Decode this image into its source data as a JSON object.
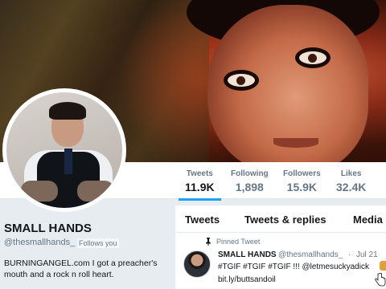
{
  "profile": {
    "name": "SMALL HANDS",
    "handle": "@thesmallhands_",
    "follows_you": "Follows you",
    "bio": "BURNINGANGEL.com I got a preacher's mouth and a rock n roll heart."
  },
  "stats": [
    {
      "label": "Tweets",
      "value": "11.9K"
    },
    {
      "label": "Following",
      "value": "1,898"
    },
    {
      "label": "Followers",
      "value": "15.9K"
    },
    {
      "label": "Likes",
      "value": "32.4K"
    }
  ],
  "tabs": [
    {
      "label": "Tweets"
    },
    {
      "label": "Tweets & replies"
    },
    {
      "label": "Media"
    }
  ],
  "tweet": {
    "pinned_label": "Pinned Tweet",
    "author_name": "SMALL HANDS",
    "author_handle": "@thesmallhands_",
    "separator": "·",
    "date": "Jul 21",
    "text": "#TGIF #TGIF #TGIF !!! @letmesuckyadick",
    "link": "bit.ly/buttsandoil"
  },
  "colors": {
    "accent": "#1da1f2",
    "text_primary": "#14171a",
    "text_secondary": "#657786",
    "background": "#e6ecf0"
  }
}
